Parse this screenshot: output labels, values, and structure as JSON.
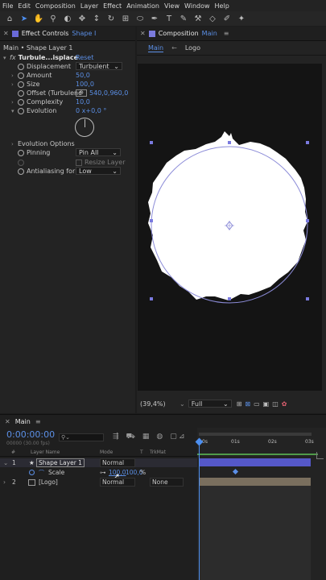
{
  "menu": [
    "File",
    "Edit",
    "Composition",
    "Layer",
    "Effect",
    "Animation",
    "View",
    "Window",
    "Help"
  ],
  "effect_controls": {
    "tab_label": "Effect Controls",
    "tab_layer": "Shape I",
    "breadcrumb": "Main • Shape Layer 1",
    "effect_name": "Turbule...isplace",
    "reset": "Reset",
    "displacement_label": "Displacement",
    "displacement_value": "Turbulent",
    "amount_label": "Amount",
    "amount_value": "50,0",
    "size_label": "Size",
    "size_value": "100,0",
    "offset_label": "Offset (Turbulenc",
    "offset_value": "540,0,960,0",
    "complexity_label": "Complexity",
    "complexity_value": "10,0",
    "evolution_label": "Evolution",
    "evolution_value": "0 x+0,0 °",
    "evolution_options_label": "Evolution Options",
    "pinning_label": "Pinning",
    "pinning_value": "Pin All",
    "resize_layer_label": "Resize Layer",
    "antialiasing_label": "Antialiasing for B",
    "antialiasing_value": "Low"
  },
  "composition": {
    "tab_label": "Composition",
    "tab_comp": "Main",
    "breadcrumbs": [
      "Main",
      "Logo"
    ],
    "zoom": "(39,4%)",
    "resolution": "Full"
  },
  "timeline": {
    "tab_label": "Main",
    "timecode": "0:00:00:00",
    "fps": "00000 (30.00 fps)",
    "search_placeholder": "",
    "col_num": "#",
    "col_layer_name": "Layer Name",
    "col_mode": "Mode",
    "col_t": "T",
    "col_trkmat": "TrkMat",
    "ruler": [
      "0s",
      "01s",
      "02s",
      "03s"
    ],
    "layers": [
      {
        "num": "1",
        "name": "Shape Layer 1",
        "mode": "Normal"
      },
      {
        "num": "2",
        "name": "[Logo]",
        "mode": "Normal",
        "trkmat": "None"
      }
    ],
    "scale_label": "Scale",
    "scale_value_a": "100,0",
    "scale_value_b": "100,0",
    "scale_unit": "%"
  },
  "colors": {
    "accent": "#4d8ff0",
    "layer1_bar": "#5558c8",
    "layer2_bar": "#7a6f5e",
    "panel": "#232323"
  }
}
